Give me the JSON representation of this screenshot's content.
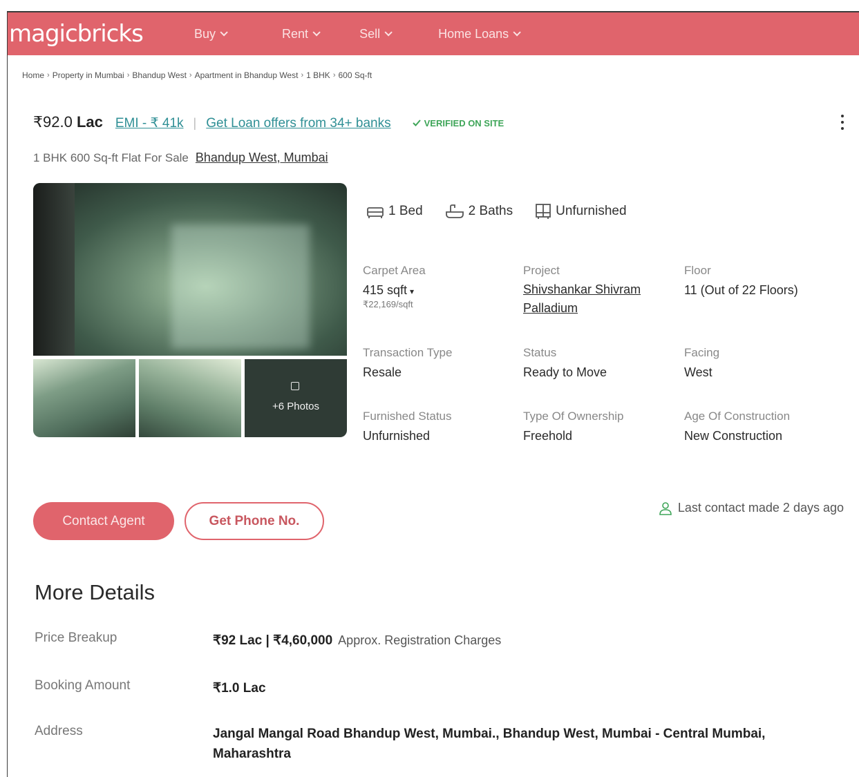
{
  "header": {
    "logo": "magicbricks",
    "brand_color": "#e0646c",
    "nav": [
      {
        "label": "Buy"
      },
      {
        "label": "Rent"
      },
      {
        "label": "Sell"
      },
      {
        "label": "Home Loans"
      }
    ]
  },
  "breadcrumb": [
    "Home",
    "Property in Mumbai",
    "Bhandup West",
    "Apartment in Bhandup West",
    "1 BHK",
    "600 Sq-ft"
  ],
  "listing": {
    "price_symbol": "₹92.0 ",
    "price_unit": "Lac",
    "emi": "EMI - ₹ 41k",
    "loan_offer": "Get Loan offers from 34+ banks",
    "verified": "VERIFIED ON SITE",
    "title": "1 BHK 600 Sq-ft Flat For Sale",
    "location": "Bhandup West, Mumbai",
    "more_photos": "+6 Photos",
    "features": {
      "bed": "1 Bed",
      "bath": "2 Baths",
      "furnishing": "Unfurnished"
    },
    "details": {
      "carpet_area": {
        "label": "Carpet Area",
        "value": "415 sqft",
        "sub": "₹22,169/sqft"
      },
      "project": {
        "label": "Project",
        "value_line1": "Shivshankar Shivram",
        "value_line2": "Palladium"
      },
      "floor": {
        "label": "Floor",
        "value": "11 (Out of 22 Floors)"
      },
      "transaction": {
        "label": "Transaction Type",
        "value": "Resale"
      },
      "status": {
        "label": "Status",
        "value": "Ready to Move"
      },
      "facing": {
        "label": "Facing",
        "value": "West"
      },
      "furnished": {
        "label": "Furnished Status",
        "value": "Unfurnished"
      },
      "ownership": {
        "label": "Type Of Ownership",
        "value": "Freehold"
      },
      "age": {
        "label": "Age Of Construction",
        "value": "New Construction"
      }
    }
  },
  "actions": {
    "contact": "Contact Agent",
    "phone": "Get Phone No.",
    "last_contact": "Last contact made 2 days ago"
  },
  "more_details": {
    "title": "More Details",
    "price_breakup": {
      "label": "Price Breakup",
      "value": "₹92 Lac | ₹4,60,000",
      "note": "Approx. Registration Charges"
    },
    "booking": {
      "label": "Booking Amount",
      "value": "₹1.0 Lac"
    },
    "address": {
      "label": "Address",
      "value": "Jangal Mangal Road Bhandup West, Mumbai., Bhandup West, Mumbai - Central Mumbai, Maharashtra"
    }
  }
}
